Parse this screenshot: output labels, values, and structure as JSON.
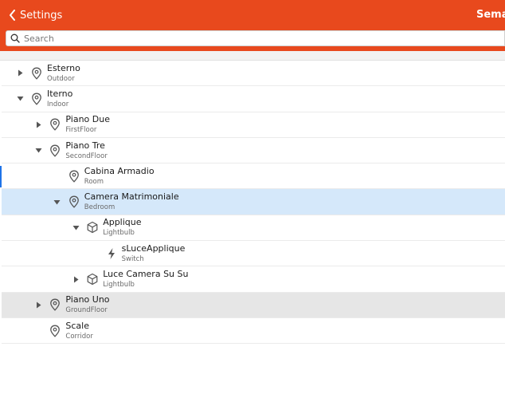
{
  "colors": {
    "accent": "#e8491d",
    "selected": "#d5e8fa",
    "hover": "#e6e6e6"
  },
  "header": {
    "back_label": "Settings",
    "title": "Semantic Model"
  },
  "search": {
    "placeholder": "Search",
    "value": ""
  },
  "tree": [
    {
      "title": "Esterno",
      "sub": "Outdoor",
      "level": 0,
      "twist": "collapsed",
      "icon": "location-pin-icon",
      "state": ""
    },
    {
      "title": "Iterno",
      "sub": "Indoor",
      "level": 0,
      "twist": "expanded",
      "icon": "location-pin-icon",
      "state": ""
    },
    {
      "title": "Piano Due",
      "sub": "FirstFloor",
      "level": 1,
      "twist": "collapsed",
      "icon": "location-pin-icon",
      "state": ""
    },
    {
      "title": "Piano Tre",
      "sub": "SecondFloor",
      "level": 1,
      "twist": "expanded",
      "icon": "location-pin-icon",
      "state": ""
    },
    {
      "title": "Cabina Armadio",
      "sub": "Room",
      "level": 2,
      "twist": "none",
      "icon": "location-pin-icon",
      "state": ""
    },
    {
      "title": "Camera Matrimoniale",
      "sub": "Bedroom",
      "level": 2,
      "twist": "expanded",
      "icon": "location-pin-icon",
      "state": "selected"
    },
    {
      "title": "Applique",
      "sub": "Lightbulb",
      "level": 3,
      "twist": "expanded",
      "icon": "cube-icon",
      "state": ""
    },
    {
      "title": "sLuceApplique",
      "sub": "Switch",
      "level": 4,
      "twist": "none",
      "icon": "lightning-icon",
      "state": ""
    },
    {
      "title": "Luce Camera Su Su",
      "sub": "Lightbulb",
      "level": 3,
      "twist": "collapsed",
      "icon": "cube-icon",
      "state": ""
    },
    {
      "title": "Piano Uno",
      "sub": "GroundFloor",
      "level": 1,
      "twist": "collapsed",
      "icon": "location-pin-icon",
      "state": "hovered"
    },
    {
      "title": "Scale",
      "sub": "Corridor",
      "level": 1,
      "twist": "none",
      "icon": "location-pin-icon",
      "state": ""
    }
  ]
}
